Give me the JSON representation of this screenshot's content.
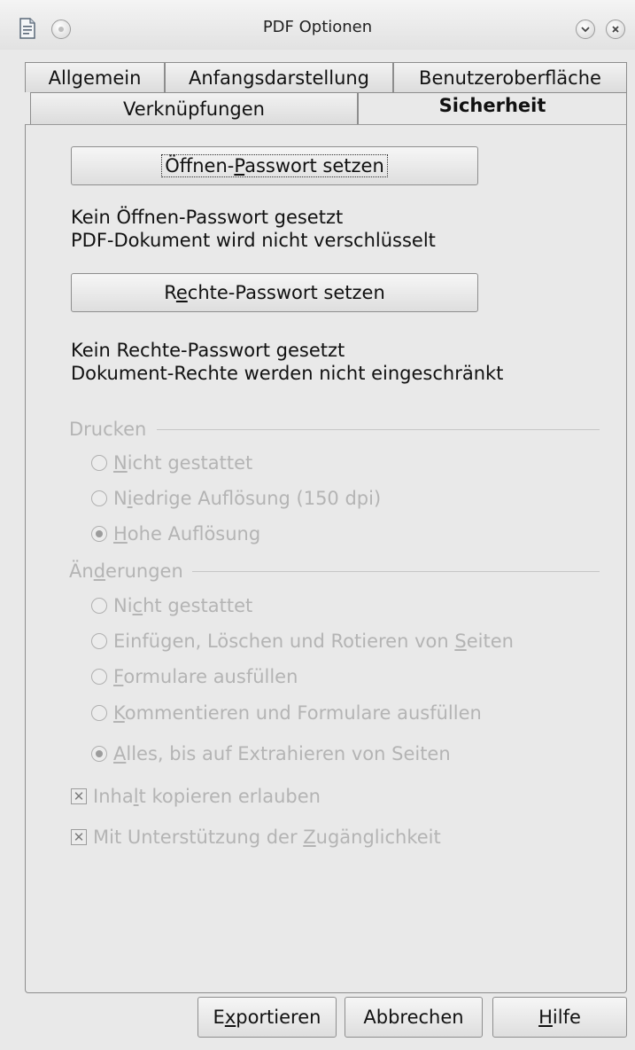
{
  "window": {
    "title": "PDF Optionen",
    "icons": {
      "app": "document-icon",
      "menu": "circle-icon",
      "minimize": "chevron-down-icon",
      "close": "close-icon"
    }
  },
  "tabs": {
    "row_back": [
      {
        "id": "allgemein",
        "label": "Allgemein"
      },
      {
        "id": "anfangsdarstellung",
        "label": "Anfangsdarstellung"
      },
      {
        "id": "benutzeroberflaeche",
        "label": "Benutzeroberfläche"
      }
    ],
    "row_front": [
      {
        "id": "verknuepfungen",
        "label": "Verknüpfungen"
      },
      {
        "id": "sicherheit",
        "label": "Sicherheit",
        "active": true
      }
    ]
  },
  "security": {
    "open_password_button": {
      "pre": "Öffnen-",
      "accel": "P",
      "post": "asswort setzen"
    },
    "open_status_line1": "Kein Öffnen-Passwort gesetzt",
    "open_status_line2": "PDF-Dokument wird nicht verschlüsselt",
    "rights_password_button": {
      "pre": "R",
      "accel": "e",
      "post": "chte-Passwort setzen"
    },
    "rights_status_line1": "Kein Rechte-Passwort gesetzt",
    "rights_status_line2": "Dokument-Rechte werden nicht eingeschränkt"
  },
  "printing": {
    "label": "Drucken",
    "options": [
      {
        "pre": "",
        "accel": "N",
        "post": "icht gestattet",
        "selected": false
      },
      {
        "pre": "N",
        "accel": "i",
        "post": "edrige Auflösung (150 dpi)",
        "selected": false
      },
      {
        "pre": "",
        "accel": "H",
        "post": "ohe Auflösung",
        "selected": true
      }
    ]
  },
  "changes": {
    "label": {
      "pre": "Än",
      "accel": "d",
      "post": "erungen"
    },
    "options": [
      {
        "pre": "Ni",
        "accel": "c",
        "post": "ht gestattet",
        "selected": false
      },
      {
        "pre": "Einfügen, Löschen und Rotieren von ",
        "accel": "S",
        "post": "eiten",
        "selected": false
      },
      {
        "pre": "",
        "accel": "F",
        "post": "ormulare ausfüllen",
        "selected": false
      },
      {
        "pre": "",
        "accel": "K",
        "post": "ommentieren und Formulare ausfüllen",
        "selected": false
      },
      {
        "pre": "",
        "accel": "A",
        "post": "lles, bis auf Extrahieren von Seiten",
        "selected": true
      }
    ]
  },
  "checkboxes": [
    {
      "pre": "Inha",
      "accel": "l",
      "post": "t kopieren erlauben",
      "checked": true
    },
    {
      "pre": "Mit Unterstützung der ",
      "accel": "Z",
      "post": "ugänglichkeit",
      "checked": true
    }
  ],
  "footer": {
    "export": {
      "pre": "E",
      "accel": "x",
      "post": "portieren"
    },
    "cancel": "Abbrechen",
    "help": {
      "pre": "",
      "accel": "H",
      "post": "ilfe"
    }
  }
}
